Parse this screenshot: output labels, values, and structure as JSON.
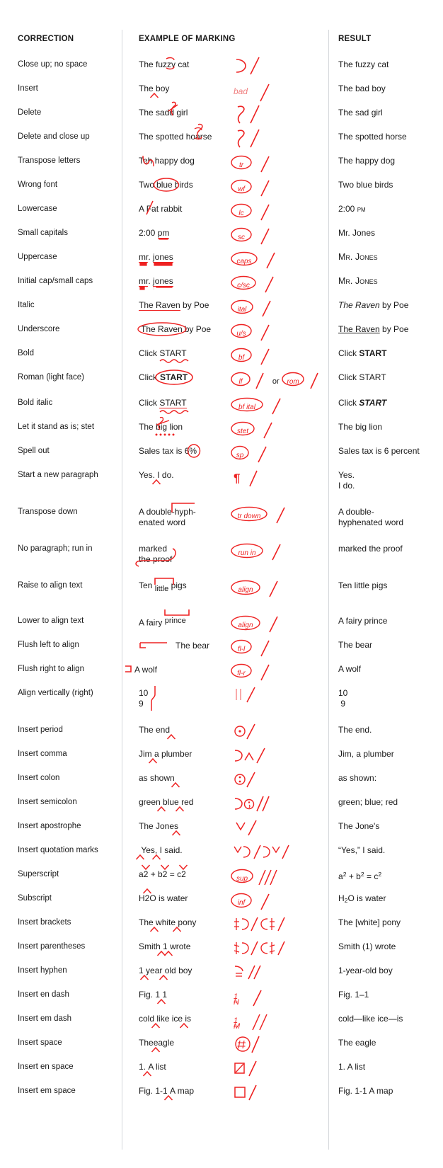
{
  "headers": {
    "correction": "CORRECTION",
    "example": "EXAMPLE OF MARKING",
    "result": "RESULT"
  },
  "colors": {
    "ink": "#ee2222",
    "text": "#1a1a1a",
    "divider": "#d4d6da",
    "background": "#ffffff"
  },
  "rows": [
    {
      "correction": "Close up; no space",
      "example": "The fuzzy cat",
      "mark": "close-up",
      "result": "The fuzzy cat"
    },
    {
      "correction": "Insert",
      "example": "The boy",
      "mark": "insert-word",
      "mark_text": "bad",
      "result": "The bad boy"
    },
    {
      "correction": "Delete",
      "example": "The sadd girl",
      "mark": "delete",
      "result": "The sad girl"
    },
    {
      "correction": "Delete and close up",
      "example": "The spotted hoarse",
      "mark": "delete-close-up",
      "result": "The spotted horse"
    },
    {
      "correction": "Transpose letters",
      "example": "Teh happy dog",
      "mark": "circled",
      "mark_text": "tr",
      "result": "The happy dog"
    },
    {
      "correction": "Wrong font",
      "example": "Two blue birds",
      "mark": "circled",
      "mark_text": "wf",
      "result": "Two blue birds"
    },
    {
      "correction": "Lowercase",
      "example": "A Fat rabbit",
      "mark": "circled",
      "mark_text": "lc",
      "result": "A fat rabbit"
    },
    {
      "correction": "Small capitals",
      "example": "2:00 pm",
      "mark": "circled",
      "mark_text": "sc",
      "result": "2:00 PM"
    },
    {
      "correction": "Uppercase",
      "example": "mr. jones",
      "mark": "circled",
      "mark_text": "caps",
      "result": "Mr. Jones"
    },
    {
      "correction": "Initial cap/small caps",
      "example": "mr. jones",
      "mark": "circled",
      "mark_text": "c/sc",
      "result": "MR. JONES"
    },
    {
      "correction": "Italic",
      "example": "The Raven by Poe",
      "mark": "circled",
      "mark_text": "ital",
      "result": "The Raven by Poe"
    },
    {
      "correction": "Underscore",
      "example": "The Raven by Poe",
      "mark": "circled",
      "mark_text": "u/s",
      "result": "The Raven by Poe"
    },
    {
      "correction": "Bold",
      "example": "Click START",
      "mark": "circled",
      "mark_text": "bf",
      "result": "Click START"
    },
    {
      "correction": "Roman (light face)",
      "example": "Click START",
      "mark": "circled-or",
      "mark_text": "lf",
      "mark_text2": "rom",
      "or_label": "or",
      "result": "Click START"
    },
    {
      "correction": "Bold italic",
      "example": "Click START",
      "mark": "circled",
      "mark_text": "bf ital",
      "result": "Click START"
    },
    {
      "correction": "Let it stand as is; stet",
      "example": "The big lion",
      "mark": "circled",
      "mark_text": "stet",
      "result": "The big lion"
    },
    {
      "correction": "Spell out",
      "example": "Sales tax is 6%",
      "mark": "circled",
      "mark_text": "sp",
      "result": "Sales tax is 6 percent"
    },
    {
      "correction": "Start a new paragraph",
      "example": "Yes. I do.",
      "mark": "pilcrow",
      "result": "Yes.\nI do."
    },
    {
      "correction": "Transpose down",
      "example": "A double-hyph-\nenated word",
      "mark": "circled",
      "mark_text": "tr down",
      "result": "A double-\nhyphenated word"
    },
    {
      "correction": "No paragraph; run in",
      "example": "marked\nthe proof",
      "mark": "circled",
      "mark_text": "run in",
      "result": "marked the proof"
    },
    {
      "correction": "Raise to align text",
      "example": "Ten little pigs",
      "mark": "circled",
      "mark_text": "align",
      "result": "Ten little pigs"
    },
    {
      "correction": "Lower to align text",
      "example": "A fairy prince",
      "mark": "circled",
      "mark_text": "align",
      "result": "A fairy prince"
    },
    {
      "correction": "Flush left to align",
      "example": "The bear",
      "mark": "circled",
      "mark_text": "fl-l",
      "result": "The bear"
    },
    {
      "correction": "Flush right to align",
      "example": "A wolf",
      "mark": "circled",
      "mark_text": "fl-r",
      "result": "A wolf"
    },
    {
      "correction": "Align vertically (right)",
      "example": "10\n9",
      "mark": "align-vertical",
      "result": "10\n 9"
    },
    {
      "correction": "Insert period",
      "example": "The end",
      "mark": "period",
      "result": "The end."
    },
    {
      "correction": "Insert comma",
      "example": "Jim a plumber",
      "mark": "comma",
      "result": "Jim, a plumber"
    },
    {
      "correction": "Insert colon",
      "example": "as shown",
      "mark": "colon",
      "result": "as shown:"
    },
    {
      "correction": "Insert semicolon",
      "example": "green blue red",
      "mark": "semicolon",
      "result": "green; blue; red"
    },
    {
      "correction": "Insert apostrophe",
      "example": "The Jones",
      "mark": "apostrophe",
      "result": "The Jone's"
    },
    {
      "correction": "Insert quotation marks",
      "example": "Yes, I said.",
      "mark": "quotes",
      "result": "“Yes,” I said."
    },
    {
      "correction": "Superscript",
      "example": "a2 + b2 = c2",
      "mark": "circled-triple",
      "mark_text": "sup",
      "result": "a2 + b2 = c2"
    },
    {
      "correction": "Subscript",
      "example": "H2O is water",
      "mark": "circled",
      "mark_text": "inf",
      "result": "H2O is water"
    },
    {
      "correction": "Insert brackets",
      "example": "The white pony",
      "mark": "brackets",
      "result": "The [white] pony"
    },
    {
      "correction": "Insert parentheses",
      "example": "Smith 1 wrote",
      "mark": "parens",
      "result": "Smith (1) wrote"
    },
    {
      "correction": "Insert hyphen",
      "example": "1 year old boy",
      "mark": "hyphen",
      "result": "1-year-old boy"
    },
    {
      "correction": "Insert en dash",
      "example": "Fig. 1 1",
      "mark": "en-dash",
      "mark_text": "1/N",
      "result": "Fig. 1–1"
    },
    {
      "correction": "Insert em dash",
      "example": "cold like ice is",
      "mark": "em-dash",
      "mark_text": "1/M",
      "result": "cold—like ice—is"
    },
    {
      "correction": "Insert space",
      "example": "Theeagle",
      "mark": "space",
      "mark_text": "#",
      "result": "The eagle"
    },
    {
      "correction": "Insert en space",
      "example": "1. A list",
      "mark": "en-space",
      "result": "1.  A list"
    },
    {
      "correction": "Insert em space",
      "example": "Fig. 1-1 A map",
      "mark": "em-space",
      "result": "Fig. 1-1   A map"
    }
  ]
}
